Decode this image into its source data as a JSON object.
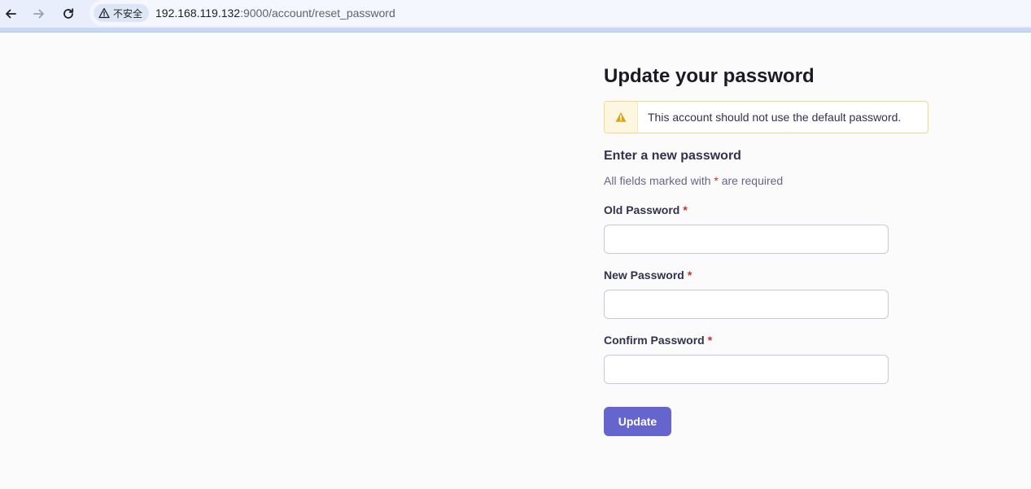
{
  "browser": {
    "security_label": "不安全",
    "url_host": "192.168.119.132",
    "url_rest": ":9000/account/reset_password"
  },
  "page": {
    "title": "Update your password",
    "alert_text": "This account should not use the default password.",
    "section_heading": "Enter a new password",
    "required_note_prefix": "All fields marked with ",
    "required_star": "*",
    "required_note_suffix": " are required"
  },
  "form": {
    "fields": [
      {
        "label": "Old Password",
        "value": "",
        "placeholder": ""
      },
      {
        "label": "New Password",
        "value": "",
        "placeholder": ""
      },
      {
        "label": "Confirm Password",
        "value": "",
        "placeholder": ""
      }
    ],
    "submit_label": "Update"
  },
  "colors": {
    "primary": "#6664cd",
    "warning_border": "#f3d88a",
    "warning_icon": "#d9a315",
    "required_star": "#d02b20"
  },
  "icons": {
    "back": "arrow-left-icon",
    "forward": "arrow-right-icon",
    "reload": "reload-icon",
    "security": "warning-triangle-icon",
    "alert": "warning-triangle-icon"
  }
}
